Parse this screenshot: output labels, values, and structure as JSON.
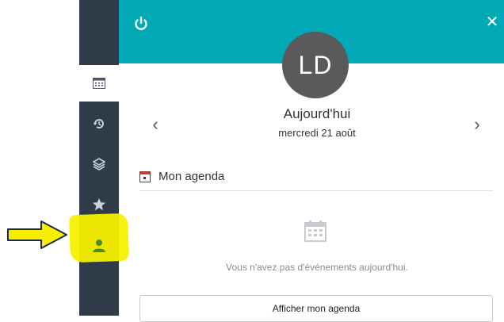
{
  "header": {
    "power_icon": "power-icon",
    "close_label": "✕",
    "accent_color": "#00a9b5"
  },
  "profile": {
    "initials": "LD"
  },
  "day_nav": {
    "prev_label": "‹",
    "next_label": "›",
    "title": "Aujourd'hui",
    "date": "mercredi 21 août"
  },
  "agenda": {
    "section_title": "Mon agenda",
    "empty_message": "Vous n'avez pas d'événements aujourd'hui.",
    "show_button_label": "Afficher mon agenda"
  },
  "sidebar": {
    "items": [
      {
        "icon": "calendar-icon"
      },
      {
        "icon": "history-icon"
      },
      {
        "icon": "layers-icon"
      },
      {
        "icon": "star-icon"
      },
      {
        "icon": "user-icon"
      }
    ]
  },
  "annotation": {
    "highlight_color": "#f6f000",
    "arrow_icon": "arrow-right-icon"
  }
}
